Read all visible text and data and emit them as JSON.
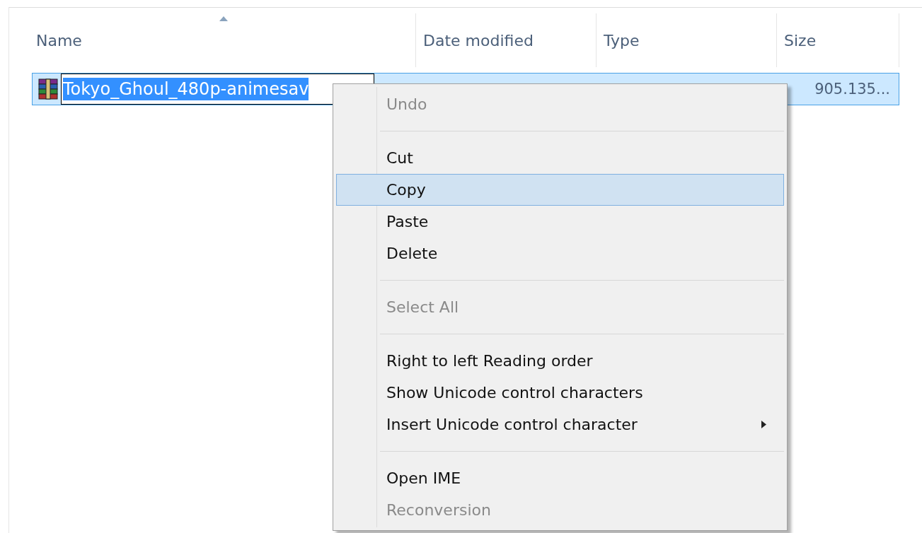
{
  "columns": [
    {
      "label": "Name",
      "sorted": true
    },
    {
      "label": "Date modified",
      "sorted": false
    },
    {
      "label": "Type",
      "sorted": false
    },
    {
      "label": "Size",
      "sorted": false
    }
  ],
  "row": {
    "selected": true,
    "rename_value": "Tokyo_Ghoul_480p-animesav",
    "size": "905.135..."
  },
  "context_menu": [
    {
      "kind": "item",
      "label": "Undo",
      "disabled": true,
      "selected": false,
      "submenu": false
    },
    {
      "kind": "separator"
    },
    {
      "kind": "item",
      "label": "Cut",
      "disabled": false,
      "selected": false,
      "submenu": false
    },
    {
      "kind": "item",
      "label": "Copy",
      "disabled": false,
      "selected": true,
      "submenu": false
    },
    {
      "kind": "item",
      "label": "Paste",
      "disabled": false,
      "selected": false,
      "submenu": false
    },
    {
      "kind": "item",
      "label": "Delete",
      "disabled": false,
      "selected": false,
      "submenu": false
    },
    {
      "kind": "separator"
    },
    {
      "kind": "item",
      "label": "Select All",
      "disabled": true,
      "selected": false,
      "submenu": false
    },
    {
      "kind": "separator"
    },
    {
      "kind": "item",
      "label": "Right to left Reading order",
      "disabled": false,
      "selected": false,
      "submenu": false
    },
    {
      "kind": "item",
      "label": "Show Unicode control characters",
      "disabled": false,
      "selected": false,
      "submenu": false
    },
    {
      "kind": "item",
      "label": "Insert Unicode control character",
      "disabled": false,
      "selected": false,
      "submenu": true
    },
    {
      "kind": "separator"
    },
    {
      "kind": "item",
      "label": "Open IME",
      "disabled": false,
      "selected": false,
      "submenu": false
    },
    {
      "kind": "item",
      "label": "Reconversion",
      "disabled": true,
      "selected": false,
      "submenu": false
    }
  ]
}
